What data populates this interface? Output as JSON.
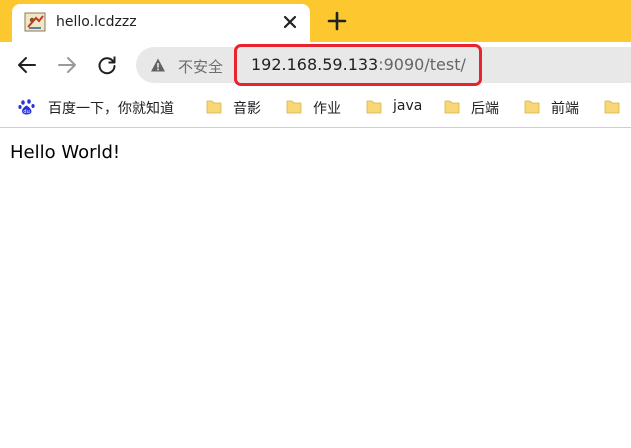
{
  "tab": {
    "title": "hello.lcdzzz",
    "close_icon": "close-icon",
    "favicon": "jar-favicon"
  },
  "new_tab": {
    "icon": "plus-icon"
  },
  "toolbar": {
    "back_icon": "arrow-left-icon",
    "forward_icon": "arrow-right-icon",
    "reload_icon": "reload-icon"
  },
  "address_bar": {
    "security_label": "不安全",
    "host": "192.168.59.133",
    "rest": ":9090/test/",
    "warning_icon": "warning-icon"
  },
  "bookmarks": [
    {
      "label": "百度一下，你就知道",
      "icon": "baidu-paw-icon"
    },
    {
      "label": "音影",
      "icon": "folder-icon"
    },
    {
      "label": "作业",
      "icon": "folder-icon"
    },
    {
      "label": "java",
      "icon": "folder-icon"
    },
    {
      "label": "后端",
      "icon": "folder-icon"
    },
    {
      "label": "前端",
      "icon": "folder-icon"
    },
    {
      "label": "",
      "icon": "folder-icon"
    }
  ],
  "page": {
    "text": "Hello World!"
  },
  "colors": {
    "tabstrip": "#fcc72f",
    "highlight": "#e9232d",
    "omnibox": "#e8e8e8",
    "folder": "#f7d776"
  }
}
